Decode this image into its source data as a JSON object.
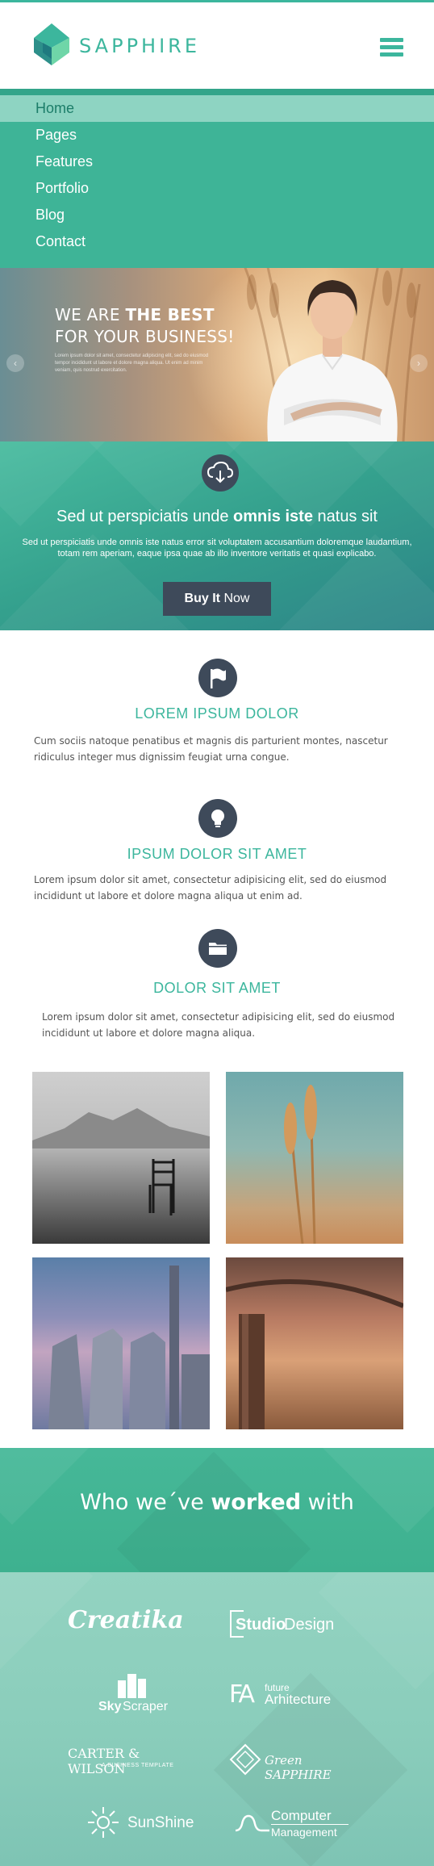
{
  "header": {
    "brand": "SAPPHIRE",
    "icons": {
      "logo": "sapphire-logo",
      "menu": "hamburger-menu-icon"
    },
    "accent_color": "#3cb69d"
  },
  "nav": {
    "items": [
      {
        "label": "Home",
        "active": true
      },
      {
        "label": "Pages",
        "active": false
      },
      {
        "label": "Features",
        "active": false
      },
      {
        "label": "Portfolio",
        "active": false
      },
      {
        "label": "Blog",
        "active": false
      },
      {
        "label": "Contact",
        "active": false
      }
    ]
  },
  "hero": {
    "title_prefix": "WE ARE ",
    "title_bold": "THE BEST",
    "title_line2": "FOR YOUR BUSINESS!",
    "body_text": "Lorem ipsum dolor sit amet, consectetur adipiscing elit, sed do eiusmod tempor incididunt ut labore et dolore magna aliqua. Ut enim ad minim veniam, quis nostrud exercitation.",
    "prev_arrow": "‹",
    "next_arrow": "›"
  },
  "cta": {
    "icon": "cloud-download-icon",
    "title_prefix": "Sed ut perspiciatis unde ",
    "title_bold": "omnis iste",
    "title_suffix": " natus sit",
    "text": "Sed ut perspiciatis unde omnis iste natus error sit voluptatem accusantium doloremque laudantium, totam rem aperiam, eaque ipsa quae ab illo inventore veritatis et quasi explicabo.",
    "button_bold": "Buy It",
    "button_rest": " Now",
    "button_color": "#3e4a5a"
  },
  "features": [
    {
      "icon": "flag-icon",
      "title": "LOREM IPSUM DOLOR",
      "text": "Cum sociis natoque penatibus et magnis dis parturient montes, nascetur ridiculus integer mus dignissim feugiat urna congue."
    },
    {
      "icon": "lightbulb-icon",
      "title": "IPSUM DOLOR SIT AMET",
      "text": "Lorem ipsum dolor sit amet, consectetur adipisicing elit, sed do eiusmod incididunt ut labore et dolore magna aliqua ut enim ad."
    },
    {
      "icon": "folder-icon",
      "title": "DOLOR SIT AMET",
      "text": "Lorem ipsum dolor sit amet, consectetur adipisicing elit, sed do eiusmod incididunt ut labore et dolore magna aliqua."
    }
  ],
  "gallery": [
    {
      "name": "lake-chair-photo"
    },
    {
      "name": "wheat-photo"
    },
    {
      "name": "skyscrapers-photo"
    },
    {
      "name": "fence-field-photo"
    }
  ],
  "worked": {
    "title_prefix": "Who we´ve ",
    "title_bold": "worked",
    "title_suffix": " with"
  },
  "clients": {
    "creatika": "Creatika",
    "studio_a": "Studio",
    "studio_b": "Design",
    "sky_a": "Sky",
    "sky_b": "Scraper",
    "fa_mark": "FA",
    "fa_line1": "future",
    "fa_line2": "Arhitecture",
    "carter": "CARTER & WILSON",
    "carter_sub": "A BUSINESS TEMPLATE",
    "green_sapphire": "Green SAPPHIRE",
    "sunshine": "SunShine",
    "computer_line1": "Computer",
    "computer_line2": "Management"
  }
}
